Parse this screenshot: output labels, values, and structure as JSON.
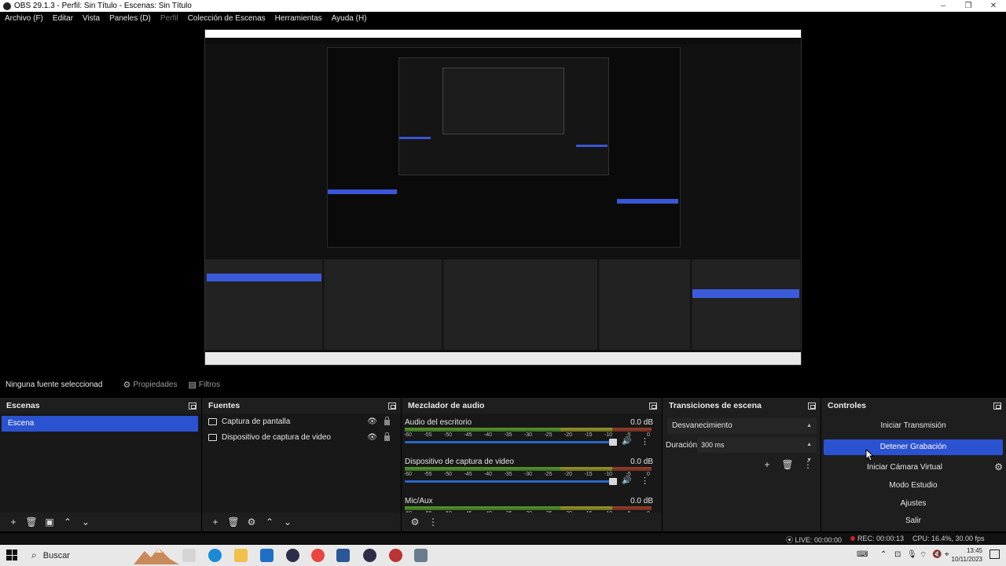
{
  "window": {
    "title": "OBS 29.1.3 - Perfil: Sin Título - Escenas: Sin Título",
    "controls": [
      "–",
      "❐",
      "✕"
    ]
  },
  "menu": {
    "items": [
      "Archivo (F)",
      "Editar",
      "Vista",
      "Paneles (D)",
      "Perfil",
      "Colección de Escenas",
      "Herramientas",
      "Ayuda (H)"
    ]
  },
  "source_toolbar": {
    "no_source": "Ninguna fuente seleccionad",
    "properties": "Propiedades",
    "filters": "Filtros"
  },
  "scenes": {
    "title": "Escenas",
    "items": [
      "Escena"
    ]
  },
  "sources": {
    "title": "Fuentes",
    "items": [
      "Captura de pantalla",
      "Dispositivo de captura de video"
    ]
  },
  "mixer": {
    "title": "Mezclador de audio",
    "channels": [
      {
        "name": "Audio del escritorio",
        "db": "0.0 dB"
      },
      {
        "name": "Dispositivo de captura de video",
        "db": "0.0 dB"
      },
      {
        "name": "Mic/Aux",
        "db": "0.0 dB"
      }
    ],
    "ticks": [
      "-60",
      "-55",
      "-50",
      "-45",
      "-40",
      "-35",
      "-30",
      "-25",
      "-20",
      "-15",
      "-10",
      "-5",
      "0"
    ]
  },
  "transitions": {
    "title": "Transiciones de escena",
    "selected": "Desvanecimiento",
    "duration_label": "Duración",
    "duration_value": "300 ms"
  },
  "controls": {
    "title": "Controles",
    "start_stream": "Iniciar Transmisión",
    "stop_recording": "Detener Grabación",
    "start_virtual_cam": "Iniciar Cámara Virtual",
    "studio_mode": "Modo Estudio",
    "settings": "Ajustes",
    "exit": "Salir"
  },
  "status": {
    "live": "LIVE: 00:00:00",
    "rec": "REC: 00:00:13",
    "cpu": "CPU: 16.4%, 30.00 fps"
  },
  "taskbar": {
    "search": "Buscar",
    "time": "13:45",
    "date": "10/11/2023"
  },
  "colors": {
    "accent": "#2b52d0",
    "panel": "#1e1e1e",
    "meter_green": "#4e8b2a",
    "meter_yellow": "#8b8b2a",
    "meter_red": "#8b3a2a"
  }
}
